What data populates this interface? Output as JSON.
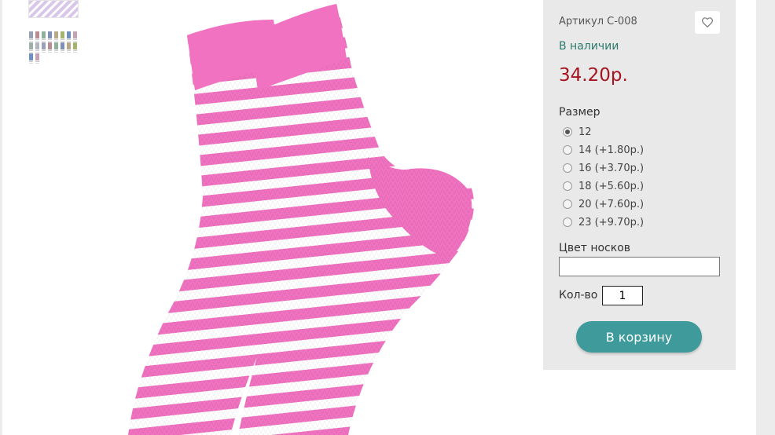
{
  "product": {
    "sku_label": "Артикул С-008",
    "stock_status": "В наличии",
    "price": "34.20р.",
    "colors": {
      "accent": "#3f9a9b",
      "price": "#a5141f",
      "stock": "#2d7a6b",
      "sock_pink": "#f072c0"
    }
  },
  "size": {
    "label": "Размер",
    "options": [
      {
        "label": "12",
        "checked": true
      },
      {
        "label": "14 (+1.80р.)",
        "checked": false
      },
      {
        "label": "16 (+3.70р.)",
        "checked": false
      },
      {
        "label": "18 (+5.60р.)",
        "checked": false
      },
      {
        "label": "20 (+7.60р.)",
        "checked": false
      },
      {
        "label": "23 (+9.70р.)",
        "checked": false
      }
    ]
  },
  "color_field": {
    "label": "Цвет носков",
    "value": ""
  },
  "quantity": {
    "label": "Кол-во",
    "value": "1"
  },
  "cart_button": {
    "label": "В корзину"
  },
  "icons": {
    "favorite": "heart-icon"
  }
}
